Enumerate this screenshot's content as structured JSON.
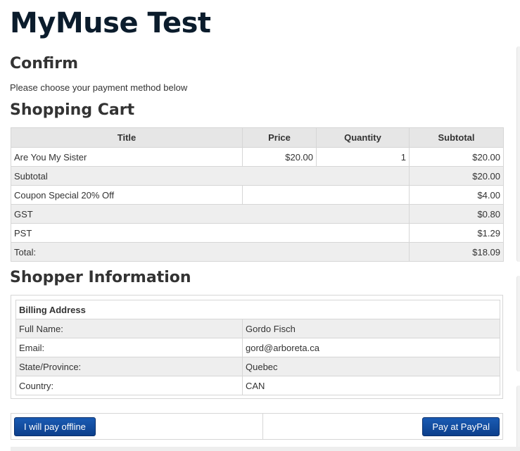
{
  "site": {
    "title": "MyMuse Test"
  },
  "confirm": {
    "heading": "Confirm",
    "intro": "Please choose your payment method below"
  },
  "cart": {
    "heading": "Shopping Cart",
    "columns": [
      "Title",
      "Price",
      "Quantity",
      "Subtotal"
    ],
    "items": [
      {
        "title": "Are You My Sister",
        "price": "$20.00",
        "quantity": "1",
        "subtotal": "$20.00"
      }
    ],
    "subtotal": {
      "label": "Subtotal",
      "value": "$20.00"
    },
    "coupon": {
      "label": "Coupon Special 20% Off",
      "value": "$4.00"
    },
    "gst": {
      "label": "GST",
      "value": "$0.80"
    },
    "pst": {
      "label": "PST",
      "value": "$1.29"
    },
    "total": {
      "label": "Total:",
      "value": "$18.09"
    }
  },
  "shopper": {
    "heading": "Shopper Information",
    "billing_header": "Billing Address",
    "rows": [
      {
        "label": "Full Name:",
        "value": "Gordo Fisch"
      },
      {
        "label": "Email:",
        "value": "gord@arboreta.ca"
      },
      {
        "label": "State/Province:",
        "value": "Quebec"
      },
      {
        "label": "Country:",
        "value": "CAN"
      }
    ]
  },
  "actions": {
    "offline_label": "I will pay offline",
    "paypal_label": "Pay at PayPal"
  },
  "colors": {
    "button": "#0c3f8c",
    "title": "#0b1c2c",
    "table_header": "#e6e6e6",
    "row_alt": "#eeeeee"
  }
}
